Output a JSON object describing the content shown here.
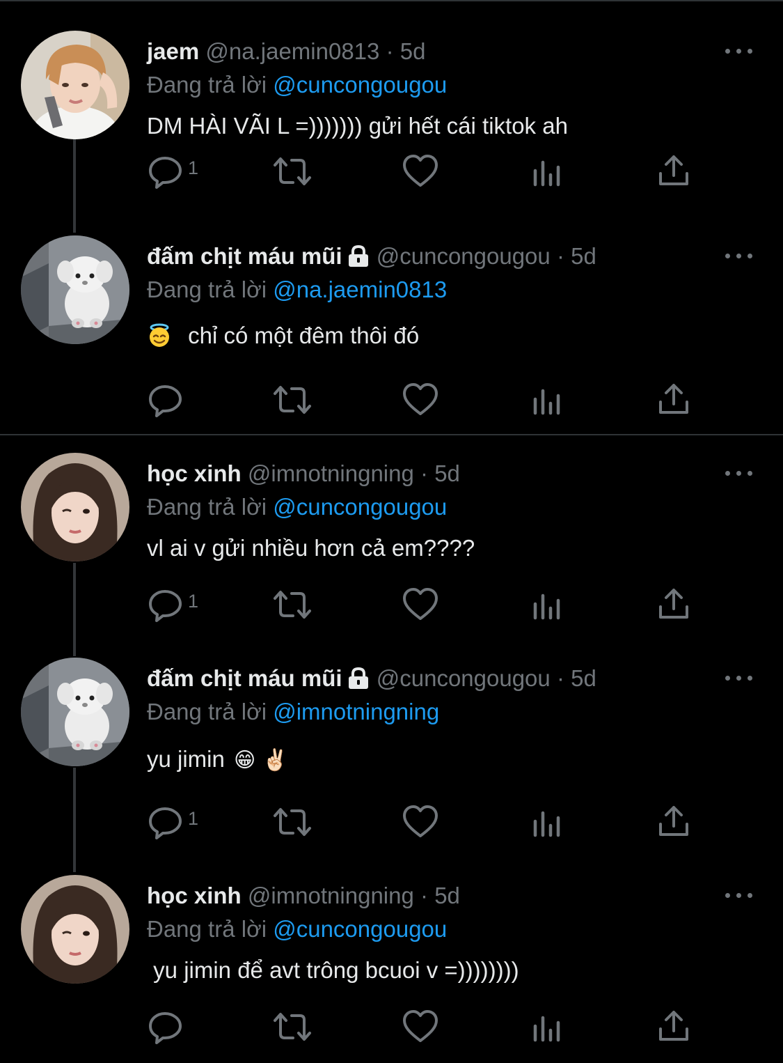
{
  "colors": {
    "background": "#000000",
    "text": "#e7e9ea",
    "secondary": "#71767b",
    "link": "#1d9bf0",
    "divider": "#2f3336"
  },
  "reply_prefix": "Đang trả lời",
  "icons": [
    "reply-icon",
    "retweet-icon",
    "like-icon",
    "views-icon",
    "share-icon",
    "more-icon",
    "lock-icon"
  ],
  "tweets": [
    {
      "name": "jaem",
      "handle": "@na.jaemin0813",
      "sep": "·",
      "time": "5d",
      "reply_to": "@cuncongougou",
      "text": "DM HÀI VÃI L =))))))) gửi hết cái tiktok ah",
      "reply_count": "1"
    },
    {
      "name": "đấm chịt máu mũi",
      "handle": "@cuncongougou",
      "sep": "·",
      "time": "5d",
      "reply_to": "@na.jaemin0813",
      "emoji": "😇",
      "text": "chỉ có một đêm thôi đó",
      "reply_count": ""
    },
    {
      "name": "học xinh",
      "handle": "@imnotningning",
      "sep": "·",
      "time": "5d",
      "reply_to": "@cuncongougou",
      "text": "vl ai v gửi nhiều hơn cả em????",
      "reply_count": "1"
    },
    {
      "name": "đấm chịt máu mũi",
      "handle": "@cuncongougou",
      "sep": "·",
      "time": "5d",
      "reply_to": "@imnotningning",
      "text": "yu jimin",
      "emoji_after": "😁 ✌🏻",
      "reply_count": "1"
    },
    {
      "name": "học xinh",
      "handle": "@imnotningning",
      "sep": "·",
      "time": "5d",
      "reply_to": "@cuncongougou",
      "text": " yu jimin để avt trông bcuoi v =))))))))",
      "reply_count": ""
    }
  ]
}
